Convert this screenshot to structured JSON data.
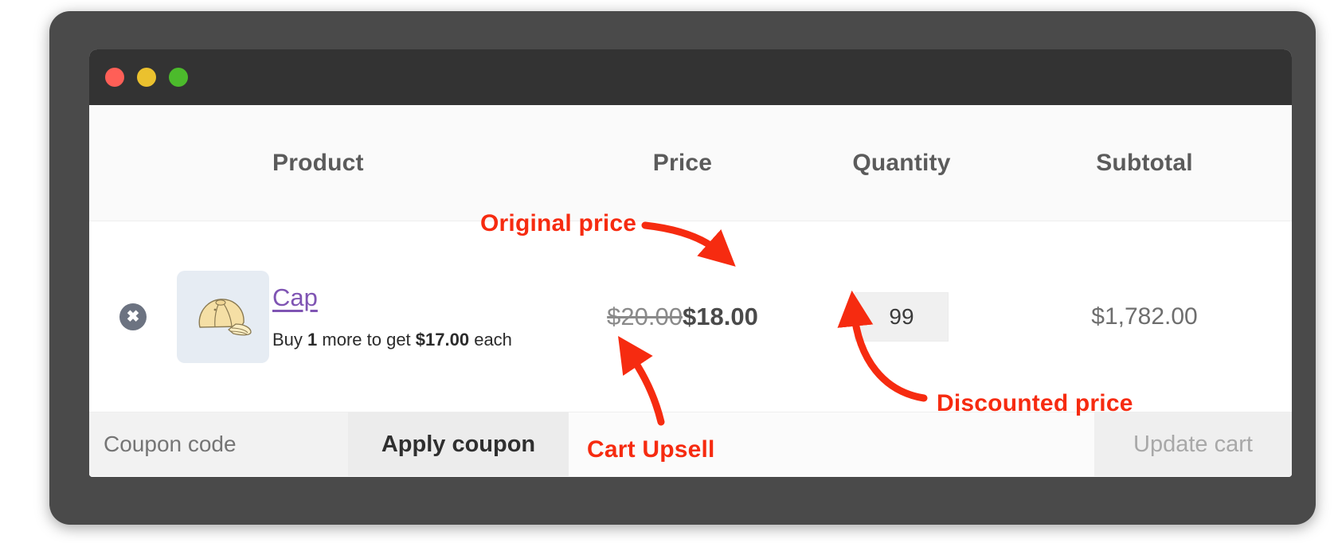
{
  "window": {
    "traffic_lights": [
      {
        "name": "close-button",
        "color": "#ff5f57"
      },
      {
        "name": "minimize-button",
        "color": "#ebc12e"
      },
      {
        "name": "maximize-button",
        "color": "#4cbb2c"
      }
    ]
  },
  "cart": {
    "columns": {
      "product": "Product",
      "price": "Price",
      "quantity": "Quantity",
      "subtotal": "Subtotal"
    },
    "item": {
      "remove_icon": "close-circle-icon",
      "thumbnail_icon": "cap-product-image",
      "name": "Cap",
      "upsell_prefix": "Buy ",
      "upsell_qty": "1",
      "upsell_middle": " more to get ",
      "upsell_price": "$17.00",
      "upsell_suffix": " each",
      "price_original": "$20.00",
      "price_discounted": "$18.00",
      "quantity": "99",
      "subtotal": "$1,782.00"
    }
  },
  "actions": {
    "coupon_placeholder": "Coupon code",
    "coupon_value": "",
    "apply_label": "Apply coupon",
    "update_label": "Update cart"
  },
  "annotations": {
    "original_price": "Original price",
    "discounted_price": "Discounted price",
    "cart_upsell": "Cart Upsell",
    "color": "#f62b10"
  }
}
